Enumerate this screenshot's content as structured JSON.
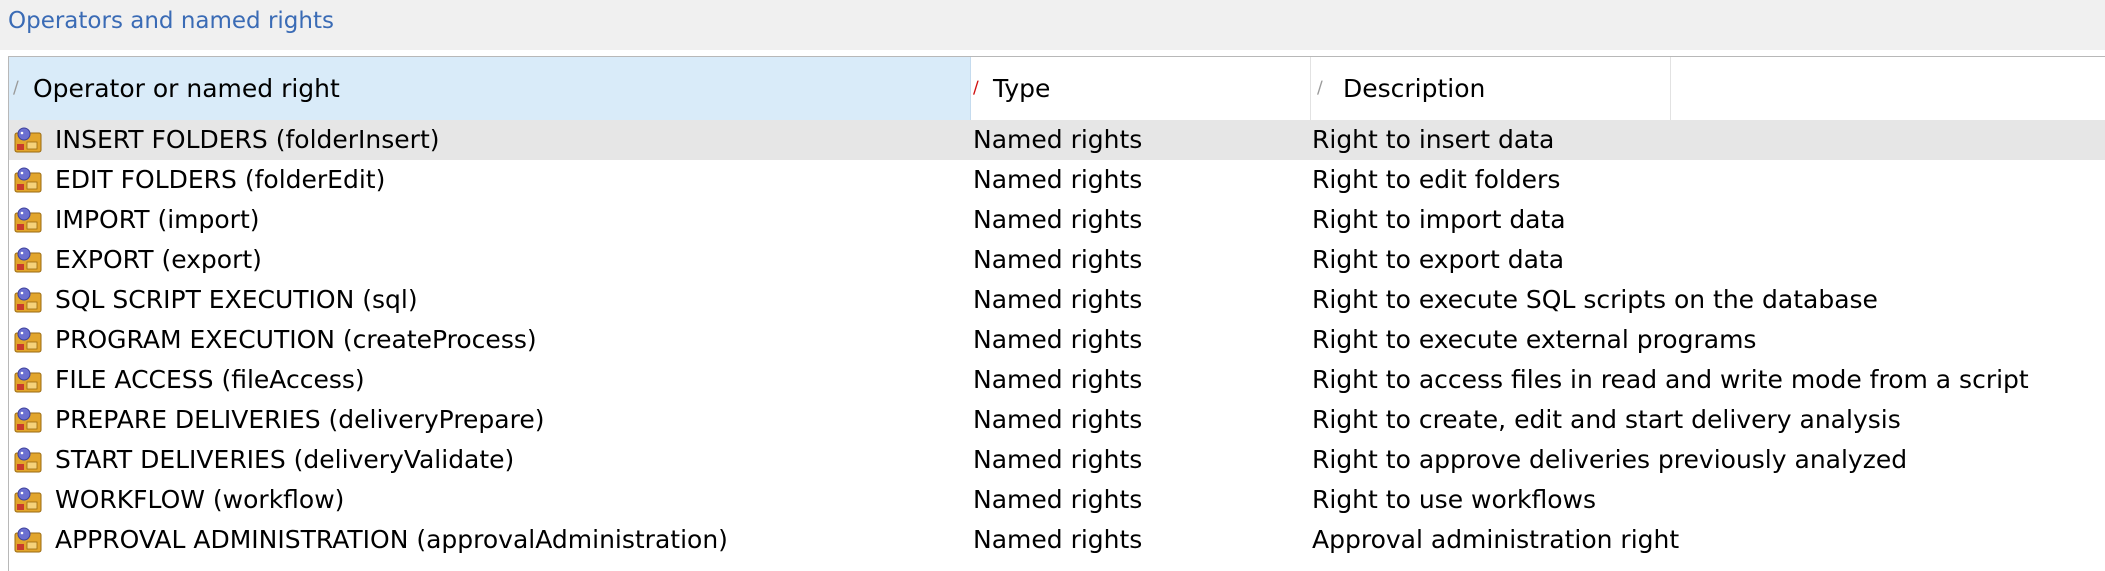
{
  "panel": {
    "title": "Operators and named rights"
  },
  "columns": [
    {
      "label": "Operator or named right",
      "sort_indicator": "gray"
    },
    {
      "label": "Type",
      "sort_indicator": "red"
    },
    {
      "label": "Description",
      "sort_indicator": "gray"
    }
  ],
  "rows": [
    {
      "name": "INSERT FOLDERS (folderInsert)",
      "type": "Named rights",
      "description": "Right to insert data",
      "icon": "named-right-icon"
    },
    {
      "name": "EDIT FOLDERS (folderEdit)",
      "type": "Named rights",
      "description": "Right to edit folders",
      "icon": "named-right-icon"
    },
    {
      "name": "IMPORT (import)",
      "type": "Named rights",
      "description": "Right to import data",
      "icon": "named-right-icon"
    },
    {
      "name": "EXPORT (export)",
      "type": "Named rights",
      "description": "Right to export data",
      "icon": "named-right-icon"
    },
    {
      "name": "SQL SCRIPT EXECUTION (sql)",
      "type": "Named rights",
      "description": "Right to execute SQL scripts on the database",
      "icon": "named-right-icon"
    },
    {
      "name": "PROGRAM EXECUTION (createProcess)",
      "type": "Named rights",
      "description": "Right to execute external programs",
      "icon": "named-right-icon"
    },
    {
      "name": "FILE ACCESS (fileAccess)",
      "type": "Named rights",
      "description": "Right to access files in read and write mode from a script",
      "icon": "named-right-icon"
    },
    {
      "name": "PREPARE DELIVERIES (deliveryPrepare)",
      "type": "Named rights",
      "description": "Right to create, edit and start delivery analysis",
      "icon": "named-right-icon"
    },
    {
      "name": "START DELIVERIES (deliveryValidate)",
      "type": "Named rights",
      "description": "Right to approve deliveries previously analyzed",
      "icon": "named-right-icon"
    },
    {
      "name": "WORKFLOW (workflow)",
      "type": "Named rights",
      "description": "Right to use workflows",
      "icon": "named-right-icon"
    },
    {
      "name": "APPROVAL ADMINISTRATION (approvalAdministration)",
      "type": "Named rights",
      "description": "Approval administration right",
      "icon": "named-right-icon"
    }
  ],
  "colors": {
    "title": "#3a6bb5",
    "header_selected": "#d9ebf9",
    "row_selected": "#e6e6e6",
    "sort_active": "#d01010"
  }
}
